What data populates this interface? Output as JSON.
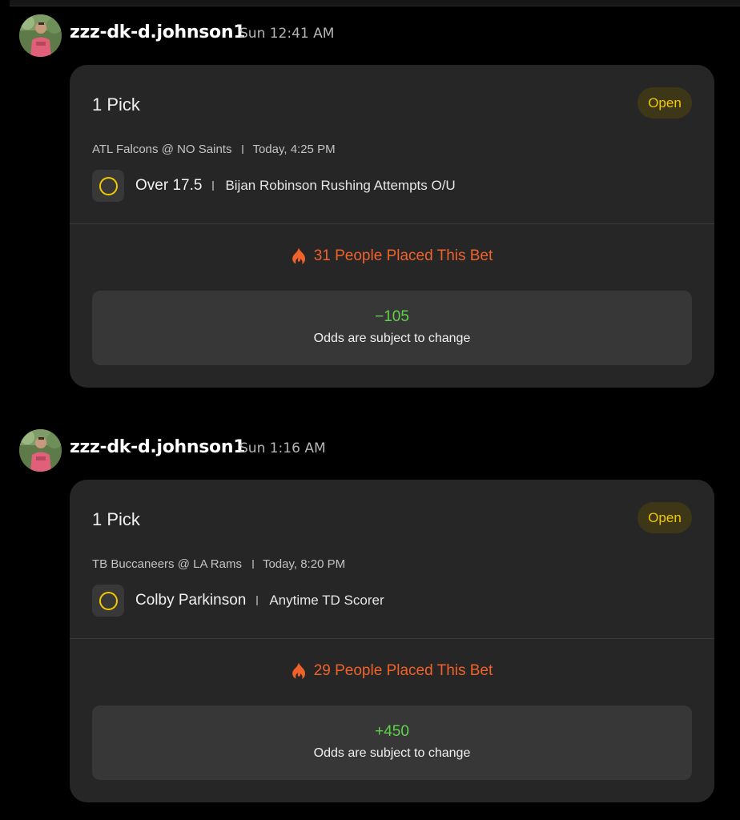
{
  "messages": [
    {
      "username": "zzz-dk-d.johnson1",
      "timestamp": "Sun 12:41 AM",
      "pick_count": "1 Pick",
      "status": "Open",
      "matchup": "ATL Falcons @ NO Saints",
      "game_time": "Today, 4:25 PM",
      "selection": "Over 17.5",
      "market": "Bijan Robinson Rushing Attempts O/U",
      "placed": "31 People Placed This Bet",
      "odds": "−105",
      "odds_note": "Odds are subject to change"
    },
    {
      "username": "zzz-dk-d.johnson1",
      "timestamp": "Sun 1:16 AM",
      "pick_count": "1 Pick",
      "status": "Open",
      "matchup": "TB Buccaneers @ LA Rams",
      "game_time": "Today, 8:20 PM",
      "selection": "Colby Parkinson",
      "market": "Anytime TD Scorer",
      "placed": "29 People Placed This Bet",
      "odds": "+450",
      "odds_note": "Odds are subject to change"
    }
  ],
  "colors": {
    "status_open": "#f2c800",
    "odds_green": "#5ed249",
    "popular_orange": "#f0622a",
    "card_bg": "#262626"
  },
  "icons": {
    "selection": "circle-outline-icon",
    "popular": "flame-icon"
  }
}
